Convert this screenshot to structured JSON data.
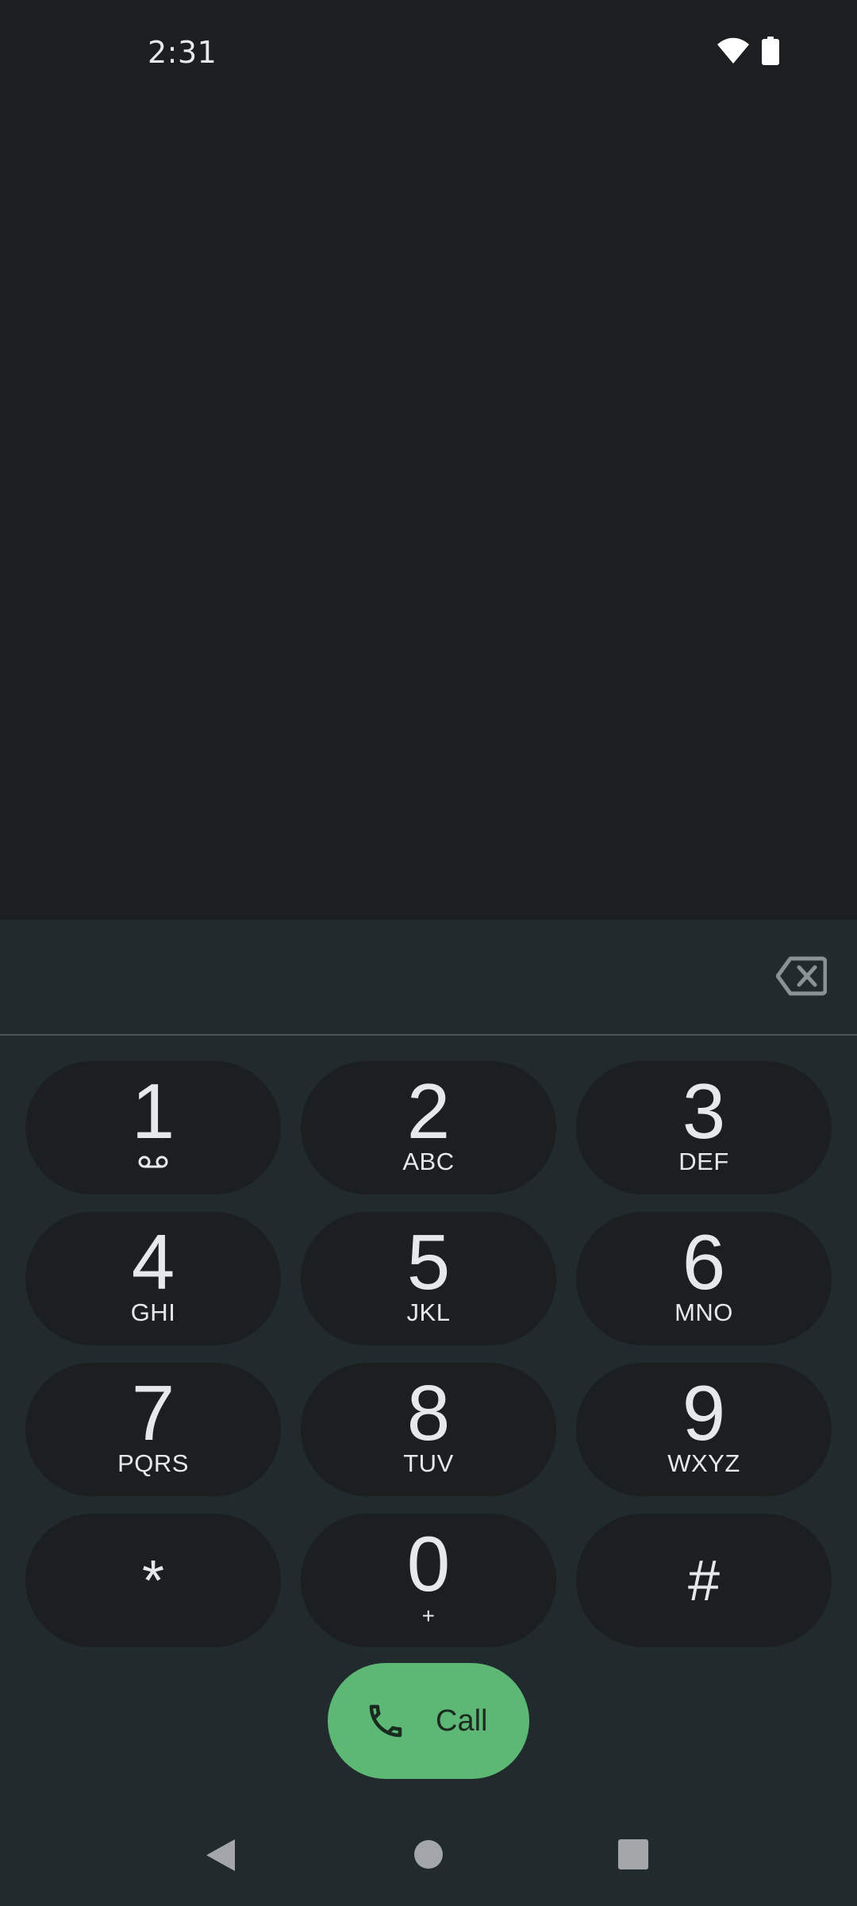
{
  "status_bar": {
    "time": "2:31",
    "icons": [
      "wifi-icon",
      "battery-icon"
    ]
  },
  "dialer": {
    "digits_value": "",
    "backspace_icon": "backspace-icon",
    "keys": [
      {
        "digit": "1",
        "letters": "",
        "sub_icon": "voicemail-icon"
      },
      {
        "digit": "2",
        "letters": "ABC"
      },
      {
        "digit": "3",
        "letters": "DEF"
      },
      {
        "digit": "4",
        "letters": "GHI"
      },
      {
        "digit": "5",
        "letters": "JKL"
      },
      {
        "digit": "6",
        "letters": "MNO"
      },
      {
        "digit": "7",
        "letters": "PQRS"
      },
      {
        "digit": "8",
        "letters": "TUV"
      },
      {
        "digit": "9",
        "letters": "WXYZ"
      },
      {
        "digit": "*",
        "letters": ""
      },
      {
        "digit": "0",
        "letters": "+"
      },
      {
        "digit": "#",
        "letters": ""
      }
    ],
    "call_label": "Call",
    "call_icon": "phone-icon"
  },
  "nav_bar": {
    "buttons": [
      "back-icon",
      "home-icon",
      "recents-icon"
    ]
  },
  "colors": {
    "background": "#1b1f20",
    "panel": "#212a2d",
    "key": "#1b1f20",
    "call_button": "#5cb874",
    "text": "#e6e9ea"
  }
}
